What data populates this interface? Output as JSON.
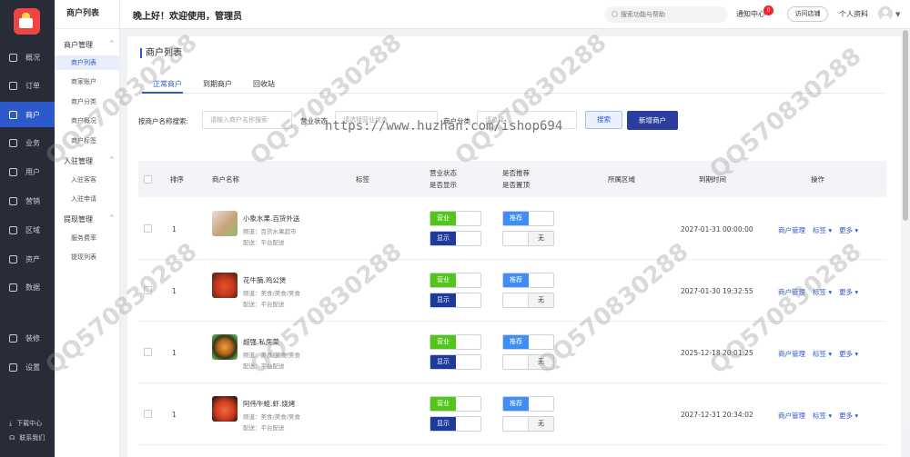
{
  "nav": {
    "items": [
      {
        "label": "概况",
        "icon": "overview-icon"
      },
      {
        "label": "订单",
        "icon": "order-icon"
      },
      {
        "label": "商户",
        "icon": "merchant-icon"
      },
      {
        "label": "业务",
        "icon": "business-icon"
      },
      {
        "label": "用户",
        "icon": "user-icon"
      },
      {
        "label": "营销",
        "icon": "marketing-icon"
      },
      {
        "label": "区域",
        "icon": "region-icon"
      },
      {
        "label": "资产",
        "icon": "asset-icon"
      },
      {
        "label": "数据",
        "icon": "data-icon"
      },
      {
        "label": "装修",
        "icon": "decorate-icon"
      },
      {
        "label": "设置",
        "icon": "settings-icon"
      }
    ],
    "download": "下载中心",
    "contact": "联系我们"
  },
  "sub": {
    "title": "商户列表",
    "group1": "商户管理",
    "items1": [
      "商户列表",
      "商家账户",
      "商户分类",
      "商户概况",
      "商户标签"
    ],
    "group2": "入驻管理",
    "items2": [
      "入驻客客",
      "入驻申请"
    ],
    "group3": "提现管理",
    "items3": [
      "服务费率",
      "提现列表"
    ]
  },
  "header": {
    "greeting": "晚上好！欢迎使用，管理员",
    "search_placeholder": "搜索功能与帮助",
    "notice": "通知中心",
    "notice_count": "0",
    "visit": "访问店铺",
    "profile": "个人资料"
  },
  "page": {
    "title": "商户列表",
    "tabs": [
      "正常商户",
      "到期商户",
      "回收站"
    ]
  },
  "filters": {
    "name_label": "按商户名称搜索:",
    "name_placeholder": "请输入商户名称搜索",
    "status_label": "营业状态",
    "status_placeholder": "请选择营业状态",
    "cat_label": "商户分类",
    "cat_placeholder": "请选择",
    "search_btn": "搜索",
    "add_btn": "新增商户"
  },
  "table": {
    "headers": {
      "sort": "排序",
      "name": "商户名称",
      "tag": "标签",
      "status1": "营业状态",
      "status2": "是否显示",
      "rec1": "是否推荐",
      "rec2": "是否置顶",
      "area": "所属区域",
      "expire": "到期时间",
      "ops": "操作"
    },
    "rows": [
      {
        "sort": "1",
        "name": "小象水果.百货外送",
        "cat": "频道：百货水果超市",
        "delivery": "配送：平台配送",
        "open": "营业",
        "show": "显示",
        "rec": "推荐",
        "top": "无",
        "date": "2027-01-31 00:00:00"
      },
      {
        "sort": "1",
        "name": "花牛腩.鸡公煲",
        "cat": "频道：美食/美食/美食",
        "delivery": "配送：平台配送",
        "open": "营业",
        "show": "显示",
        "rec": "推荐",
        "top": "无",
        "date": "2027-01-30 19:32:55"
      },
      {
        "sort": "1",
        "name": "超强.私房菜",
        "cat": "频道：美食/美食/美食",
        "delivery": "配送：平台配送",
        "open": "营业",
        "show": "显示",
        "rec": "推荐",
        "top": "无",
        "date": "2025-12-18 20:01:25"
      },
      {
        "sort": "1",
        "name": "阿伟牛蛙.虾.烧烤",
        "cat": "频道：美食/美食/美食",
        "delivery": "配送：平台配送",
        "open": "营业",
        "show": "显示",
        "rec": "推荐",
        "top": "无",
        "date": "2027-12-31 20:34:02"
      }
    ],
    "ops": {
      "manage": "商户管理",
      "tag": "标签 ▾",
      "more": "更多 ▾"
    }
  },
  "watermark": {
    "qq": "QQ570830288",
    "url": "https://www.huzhan.com/ishop694"
  },
  "colors": {
    "accent": "#2c5acb",
    "nav_bg": "#282c38",
    "green": "#52c41a",
    "navy": "#1e3a9b",
    "blue": "#3e8ef5"
  }
}
